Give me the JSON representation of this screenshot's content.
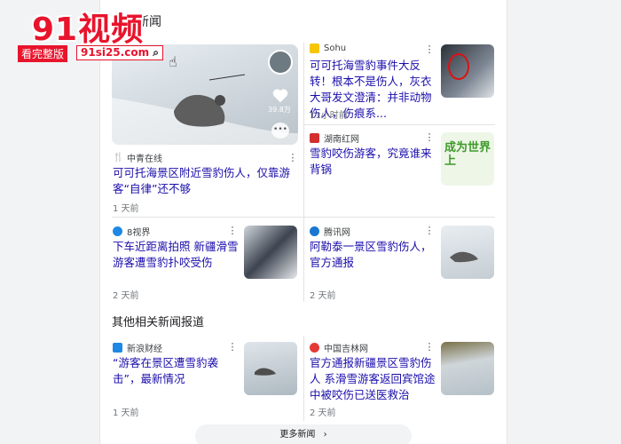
{
  "section": {
    "title": "热点新闻",
    "other_title": "其他相关新闻报道"
  },
  "watermark": {
    "logo_text": "91视频",
    "badge_label": "看完整版",
    "url": "91si25.com"
  },
  "featured": {
    "source": "中青在线",
    "headline": "可可托海景区附近雪豹伤人，仅靠游客“自律”还不够",
    "time": "1 天前",
    "like_count": "39.8万"
  },
  "articles": [
    {
      "source": "Sohu",
      "headline": "可可托海雪豹事件大反转！根本不是伤人，灰衣大哥发文澄清：并非动物伤人，伤痕系...",
      "time": "11小时前"
    },
    {
      "source": "湖南红网",
      "headline": "雪豹咬伤游客，究竟谁来背锅",
      "time": "",
      "thumb_text": "成为世界上"
    },
    {
      "source": "8视界",
      "headline": "下车近距离拍照 新疆滑雪游客遭雪豹扑咬受伤",
      "time": "2 天前"
    },
    {
      "source": "腾讯网",
      "headline": "阿勒泰一景区雪豹伤人，官方通报",
      "time": "2 天前"
    }
  ],
  "other": [
    {
      "source": "新浪财经",
      "headline": "“游客在景区遭雪豹袭击”，最新情况",
      "time": "1 天前"
    },
    {
      "source": "中国吉林网",
      "headline": "官方通报新疆景区雪豹伤人 系滑雪游客返回宾馆途中被咬伤已送医救治",
      "time": "2 天前"
    }
  ],
  "more_button": {
    "label": "更多新闻"
  },
  "colors": {
    "link": "#1a0dab",
    "watermark_red": "#e8142c",
    "time": "#70757a"
  },
  "icons": {
    "kebab": "more-vert-icon",
    "heart": "heart-icon",
    "comment": "comment-icon",
    "search": "search-icon",
    "pointer": "hand-pointer-icon",
    "chevron": "chevron-right-icon"
  }
}
